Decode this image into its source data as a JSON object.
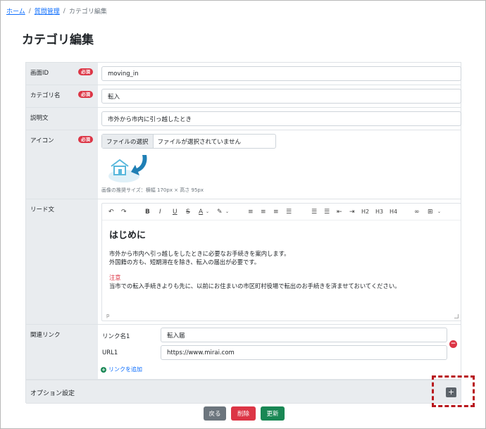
{
  "breadcrumb": {
    "home": "ホーム",
    "sep1": "/",
    "manage": "質問管理",
    "sep2": "/",
    "current": "カテゴリ編集"
  },
  "page_title": "カテゴリ編集",
  "required_badge": "必須",
  "fields": {
    "screen_id": {
      "label": "画面ID",
      "value": "moving_in"
    },
    "category_name": {
      "label": "カテゴリ名",
      "value": "転入"
    },
    "description": {
      "label": "説明文",
      "value": "市外から市内に引っ越したとき"
    },
    "icon": {
      "label": "アイコン",
      "file_button": "ファイルの選択",
      "file_status": "ファイルが選択されていません",
      "size_note": "画像の推奨サイズ：横幅 170px × 高さ 95px"
    },
    "lead": {
      "label": "リード文",
      "heading": "はじめに",
      "para1_line1": "市外から市内へ引っ越しをしたときに必要なお手続きを案内します。",
      "para1_line2": "外国籍の方も、短期滞在を除き、転入の届出が必要です。",
      "warn": "注意",
      "para2": "当市での転入手続きよりも先に、以前にお住まいの市区町村役場で転出のお手続きを済ませておいてください。",
      "status": "p"
    },
    "links": {
      "label": "関連リンク",
      "name_label": "リンク名1",
      "name_value": "転入届",
      "url_label": "URL1",
      "url_value": "https://www.mirai.com",
      "add_label": "リンクを追加"
    }
  },
  "toolbar": {
    "bold": "B",
    "italic": "I",
    "underline": "U",
    "strike": "S",
    "font_color": "A",
    "h2": "H2",
    "h3": "H3",
    "h4": "H4"
  },
  "options": {
    "label": "オプション設定",
    "plus": "+"
  },
  "buttons": {
    "back": "戻る",
    "delete": "削除",
    "update": "更新"
  },
  "colors": {
    "required": "#dc3545",
    "primary_link": "#0d6efd",
    "delete": "#dc3545",
    "update": "#198754",
    "back": "#6c757d",
    "highlight": "#b8171d"
  }
}
